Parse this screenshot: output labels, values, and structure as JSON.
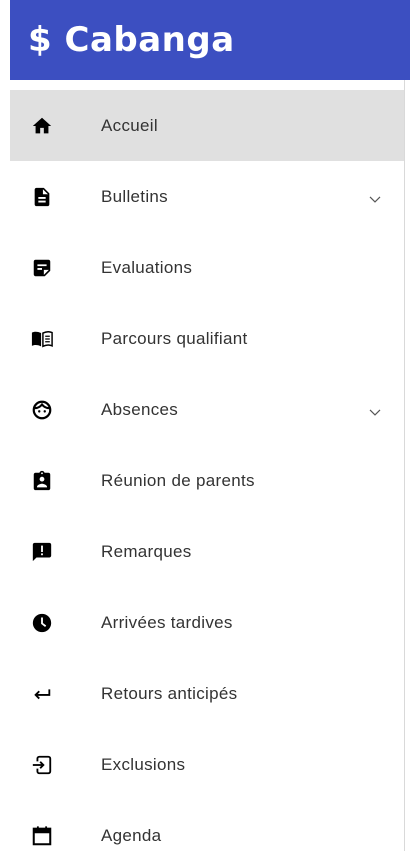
{
  "app": {
    "name": "Cabanga",
    "logo_text": "$ Cabanga",
    "header_color": "#3c4fc1",
    "active_bg": "#e0e0e0"
  },
  "menu": {
    "items": [
      {
        "label": "Accueil",
        "icon": "home-icon",
        "active": true,
        "expandable": false
      },
      {
        "label": "Bulletins",
        "icon": "document-icon",
        "active": false,
        "expandable": true
      },
      {
        "label": "Evaluations",
        "icon": "note-icon",
        "active": false,
        "expandable": false
      },
      {
        "label": "Parcours qualifiant",
        "icon": "book-icon",
        "active": false,
        "expandable": false
      },
      {
        "label": "Absences",
        "icon": "face-icon",
        "active": false,
        "expandable": true
      },
      {
        "label": "Réunion de parents",
        "icon": "clipboard-person-icon",
        "active": false,
        "expandable": false
      },
      {
        "label": "Remarques",
        "icon": "feedback-icon",
        "active": false,
        "expandable": false
      },
      {
        "label": "Arrivées tardives",
        "icon": "clock-icon",
        "active": false,
        "expandable": false
      },
      {
        "label": "Retours anticipés",
        "icon": "return-arrow-icon",
        "active": false,
        "expandable": false
      },
      {
        "label": "Exclusions",
        "icon": "exit-icon",
        "active": false,
        "expandable": false
      },
      {
        "label": "Agenda",
        "icon": "calendar-icon",
        "active": false,
        "expandable": false
      }
    ]
  }
}
